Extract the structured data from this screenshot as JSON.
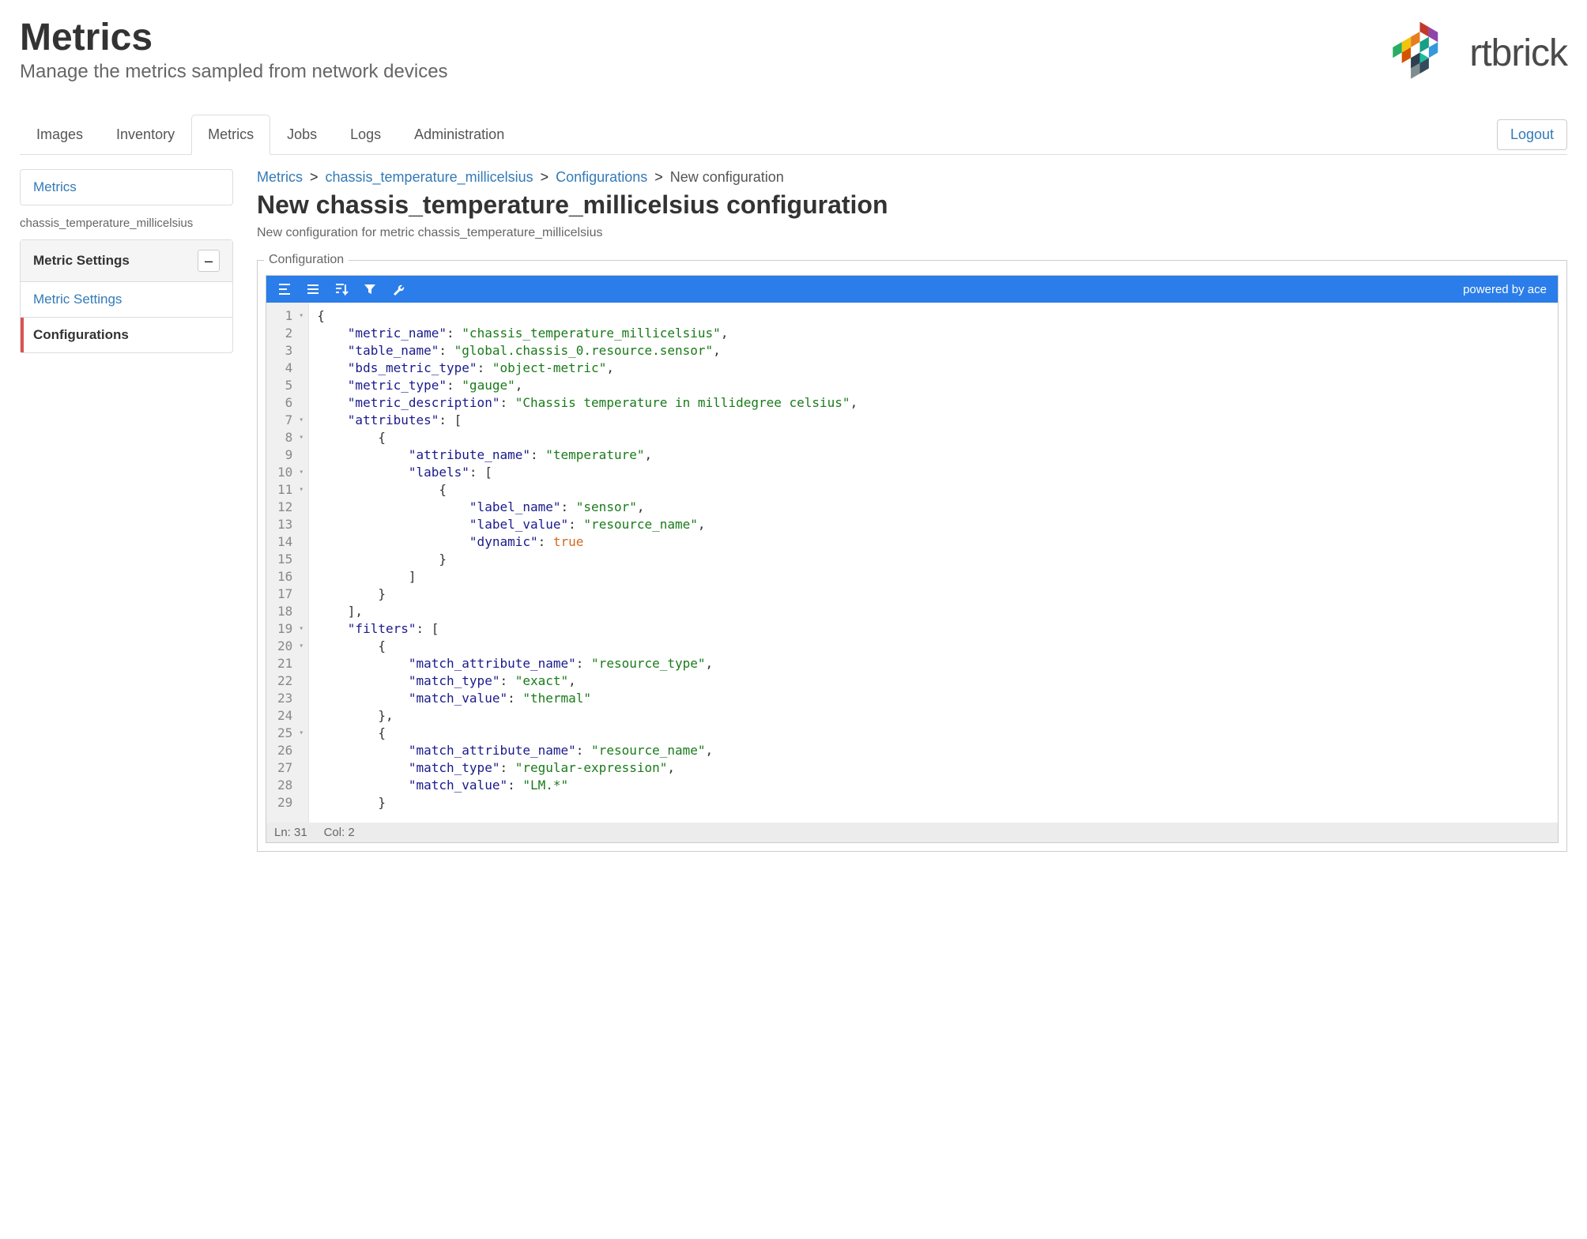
{
  "header": {
    "title": "Metrics",
    "subtitle": "Manage the metrics sampled from network devices"
  },
  "brand": {
    "name": "rtbrick"
  },
  "nav": {
    "tabs": [
      "Images",
      "Inventory",
      "Metrics",
      "Jobs",
      "Logs",
      "Administration"
    ],
    "active": "Metrics",
    "logout": "Logout"
  },
  "sidebar": {
    "top_link": "Metrics",
    "metric_label": "chassis_temperature_millicelsius",
    "settings_header": "Metric Settings",
    "items": [
      {
        "label": "Metric Settings",
        "active": false
      },
      {
        "label": "Configurations",
        "active": true
      }
    ]
  },
  "breadcrumb": {
    "parts": [
      {
        "label": "Metrics",
        "link": true
      },
      {
        "label": "chassis_temperature_millicelsius",
        "link": true
      },
      {
        "label": "Configurations",
        "link": true
      },
      {
        "label": "New configuration",
        "link": false
      }
    ]
  },
  "page": {
    "heading": "New chassis_temperature_millicelsius configuration",
    "subtitle": "New configuration for metric chassis_temperature_millicelsius",
    "fieldset_label": "Configuration"
  },
  "editor": {
    "powered": "powered by ace",
    "status_line": "Ln: 31",
    "status_col": "Col: 2",
    "lines": [
      {
        "n": 1,
        "fold": true,
        "html": "<span class='tok-punc'>{</span>"
      },
      {
        "n": 2,
        "html": "    <span class='tok-key'>\"metric_name\"</span><span class='tok-punc'>: </span><span class='tok-str'>\"chassis_temperature_millicelsius\"</span><span class='tok-punc'>,</span>"
      },
      {
        "n": 3,
        "html": "    <span class='tok-key'>\"table_name\"</span><span class='tok-punc'>: </span><span class='tok-str'>\"global.chassis_0.resource.sensor\"</span><span class='tok-punc'>,</span>"
      },
      {
        "n": 4,
        "html": "    <span class='tok-key'>\"bds_metric_type\"</span><span class='tok-punc'>: </span><span class='tok-str'>\"object-metric\"</span><span class='tok-punc'>,</span>"
      },
      {
        "n": 5,
        "html": "    <span class='tok-key'>\"metric_type\"</span><span class='tok-punc'>: </span><span class='tok-str'>\"gauge\"</span><span class='tok-punc'>,</span>"
      },
      {
        "n": 6,
        "html": "    <span class='tok-key'>\"metric_description\"</span><span class='tok-punc'>: </span><span class='tok-str'>\"Chassis temperature in millidegree celsius\"</span><span class='tok-punc'>,</span>"
      },
      {
        "n": 7,
        "fold": true,
        "html": "    <span class='tok-key'>\"attributes\"</span><span class='tok-punc'>: [</span>"
      },
      {
        "n": 8,
        "fold": true,
        "html": "        <span class='tok-punc'>{</span>"
      },
      {
        "n": 9,
        "html": "            <span class='tok-key'>\"attribute_name\"</span><span class='tok-punc'>: </span><span class='tok-str'>\"temperature\"</span><span class='tok-punc'>,</span>"
      },
      {
        "n": 10,
        "fold": true,
        "html": "            <span class='tok-key'>\"labels\"</span><span class='tok-punc'>: [</span>"
      },
      {
        "n": 11,
        "fold": true,
        "html": "                <span class='tok-punc'>{</span>"
      },
      {
        "n": 12,
        "html": "                    <span class='tok-key'>\"label_name\"</span><span class='tok-punc'>: </span><span class='tok-str'>\"sensor\"</span><span class='tok-punc'>,</span>"
      },
      {
        "n": 13,
        "html": "                    <span class='tok-key'>\"label_value\"</span><span class='tok-punc'>: </span><span class='tok-str'>\"resource_name\"</span><span class='tok-punc'>,</span>"
      },
      {
        "n": 14,
        "html": "                    <span class='tok-key'>\"dynamic\"</span><span class='tok-punc'>: </span><span class='tok-bool'>true</span>"
      },
      {
        "n": 15,
        "html": "                <span class='tok-punc'>}</span>"
      },
      {
        "n": 16,
        "html": "            <span class='tok-punc'>]</span>"
      },
      {
        "n": 17,
        "html": "        <span class='tok-punc'>}</span>"
      },
      {
        "n": 18,
        "html": "    <span class='tok-punc'>],</span>"
      },
      {
        "n": 19,
        "fold": true,
        "html": "    <span class='tok-key'>\"filters\"</span><span class='tok-punc'>: [</span>"
      },
      {
        "n": 20,
        "fold": true,
        "html": "        <span class='tok-punc'>{</span>"
      },
      {
        "n": 21,
        "html": "            <span class='tok-key'>\"match_attribute_name\"</span><span class='tok-punc'>: </span><span class='tok-str'>\"resource_type\"</span><span class='tok-punc'>,</span>"
      },
      {
        "n": 22,
        "html": "            <span class='tok-key'>\"match_type\"</span><span class='tok-punc'>: </span><span class='tok-str'>\"exact\"</span><span class='tok-punc'>,</span>"
      },
      {
        "n": 23,
        "html": "            <span class='tok-key'>\"match_value\"</span><span class='tok-punc'>: </span><span class='tok-str'>\"thermal\"</span>"
      },
      {
        "n": 24,
        "html": "        <span class='tok-punc'>},</span>"
      },
      {
        "n": 25,
        "fold": true,
        "html": "        <span class='tok-punc'>{</span>"
      },
      {
        "n": 26,
        "html": "            <span class='tok-key'>\"match_attribute_name\"</span><span class='tok-punc'>: </span><span class='tok-str'>\"resource_name\"</span><span class='tok-punc'>,</span>"
      },
      {
        "n": 27,
        "html": "            <span class='tok-key'>\"match_type\"</span><span class='tok-punc'>: </span><span class='tok-str'>\"regular-expression\"</span><span class='tok-punc'>,</span>"
      },
      {
        "n": 28,
        "html": "            <span class='tok-key'>\"match_value\"</span><span class='tok-punc'>: </span><span class='tok-str'>\"LM.*\"</span>"
      },
      {
        "n": 29,
        "html": "        <span class='tok-punc'>}</span>"
      }
    ]
  }
}
